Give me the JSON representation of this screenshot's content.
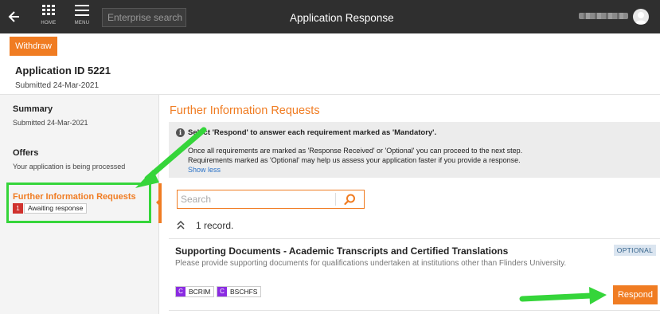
{
  "topbar": {
    "home_label": "HOME",
    "menu_label": "MENU",
    "search_placeholder": "Enterprise search",
    "title": "Application Response"
  },
  "header": {
    "withdraw_label": "Withdraw",
    "application_id": "Application ID 5221",
    "submitted": "Submitted 24-Mar-2021"
  },
  "sidebar": {
    "items": [
      {
        "title": "Summary",
        "subtitle": "Submitted 24-Mar-2021"
      },
      {
        "title": "Offers",
        "subtitle": "Your application is being processed"
      },
      {
        "title": "Further Information Requests",
        "badge_count": "1",
        "badge_text": "Awaiting response"
      }
    ]
  },
  "main": {
    "title": "Further Information Requests",
    "info": {
      "heading": "Select 'Respond' to answer each requirement marked as 'Mandatory'.",
      "line1": "Once all requirements are marked as 'Response Received' or 'Optional' you can proceed to the next step.",
      "line2": "Requirements marked as 'Optional' may help us assess your application faster if you provide a response.",
      "show_less": "Show less"
    },
    "search_placeholder": "Search",
    "records": "1 record.",
    "requirement": {
      "title": "Supporting Documents - Academic Transcripts and Certified Translations",
      "tag": "OPTIONAL",
      "description": "Please provide supporting documents for qualifications undertaken at institutions other than Flinders University.",
      "courses": [
        {
          "letter": "C",
          "code": "BCRIM"
        },
        {
          "letter": "C",
          "code": "BSCHFS"
        }
      ],
      "respond_label": "Respond"
    }
  },
  "colors": {
    "topbar": "#2f2f2f",
    "accent": "#f07c22",
    "highlight": "#35d53a",
    "badge": "#d0322e",
    "course_tag": "#8a2be2",
    "link": "#2a72c8"
  }
}
